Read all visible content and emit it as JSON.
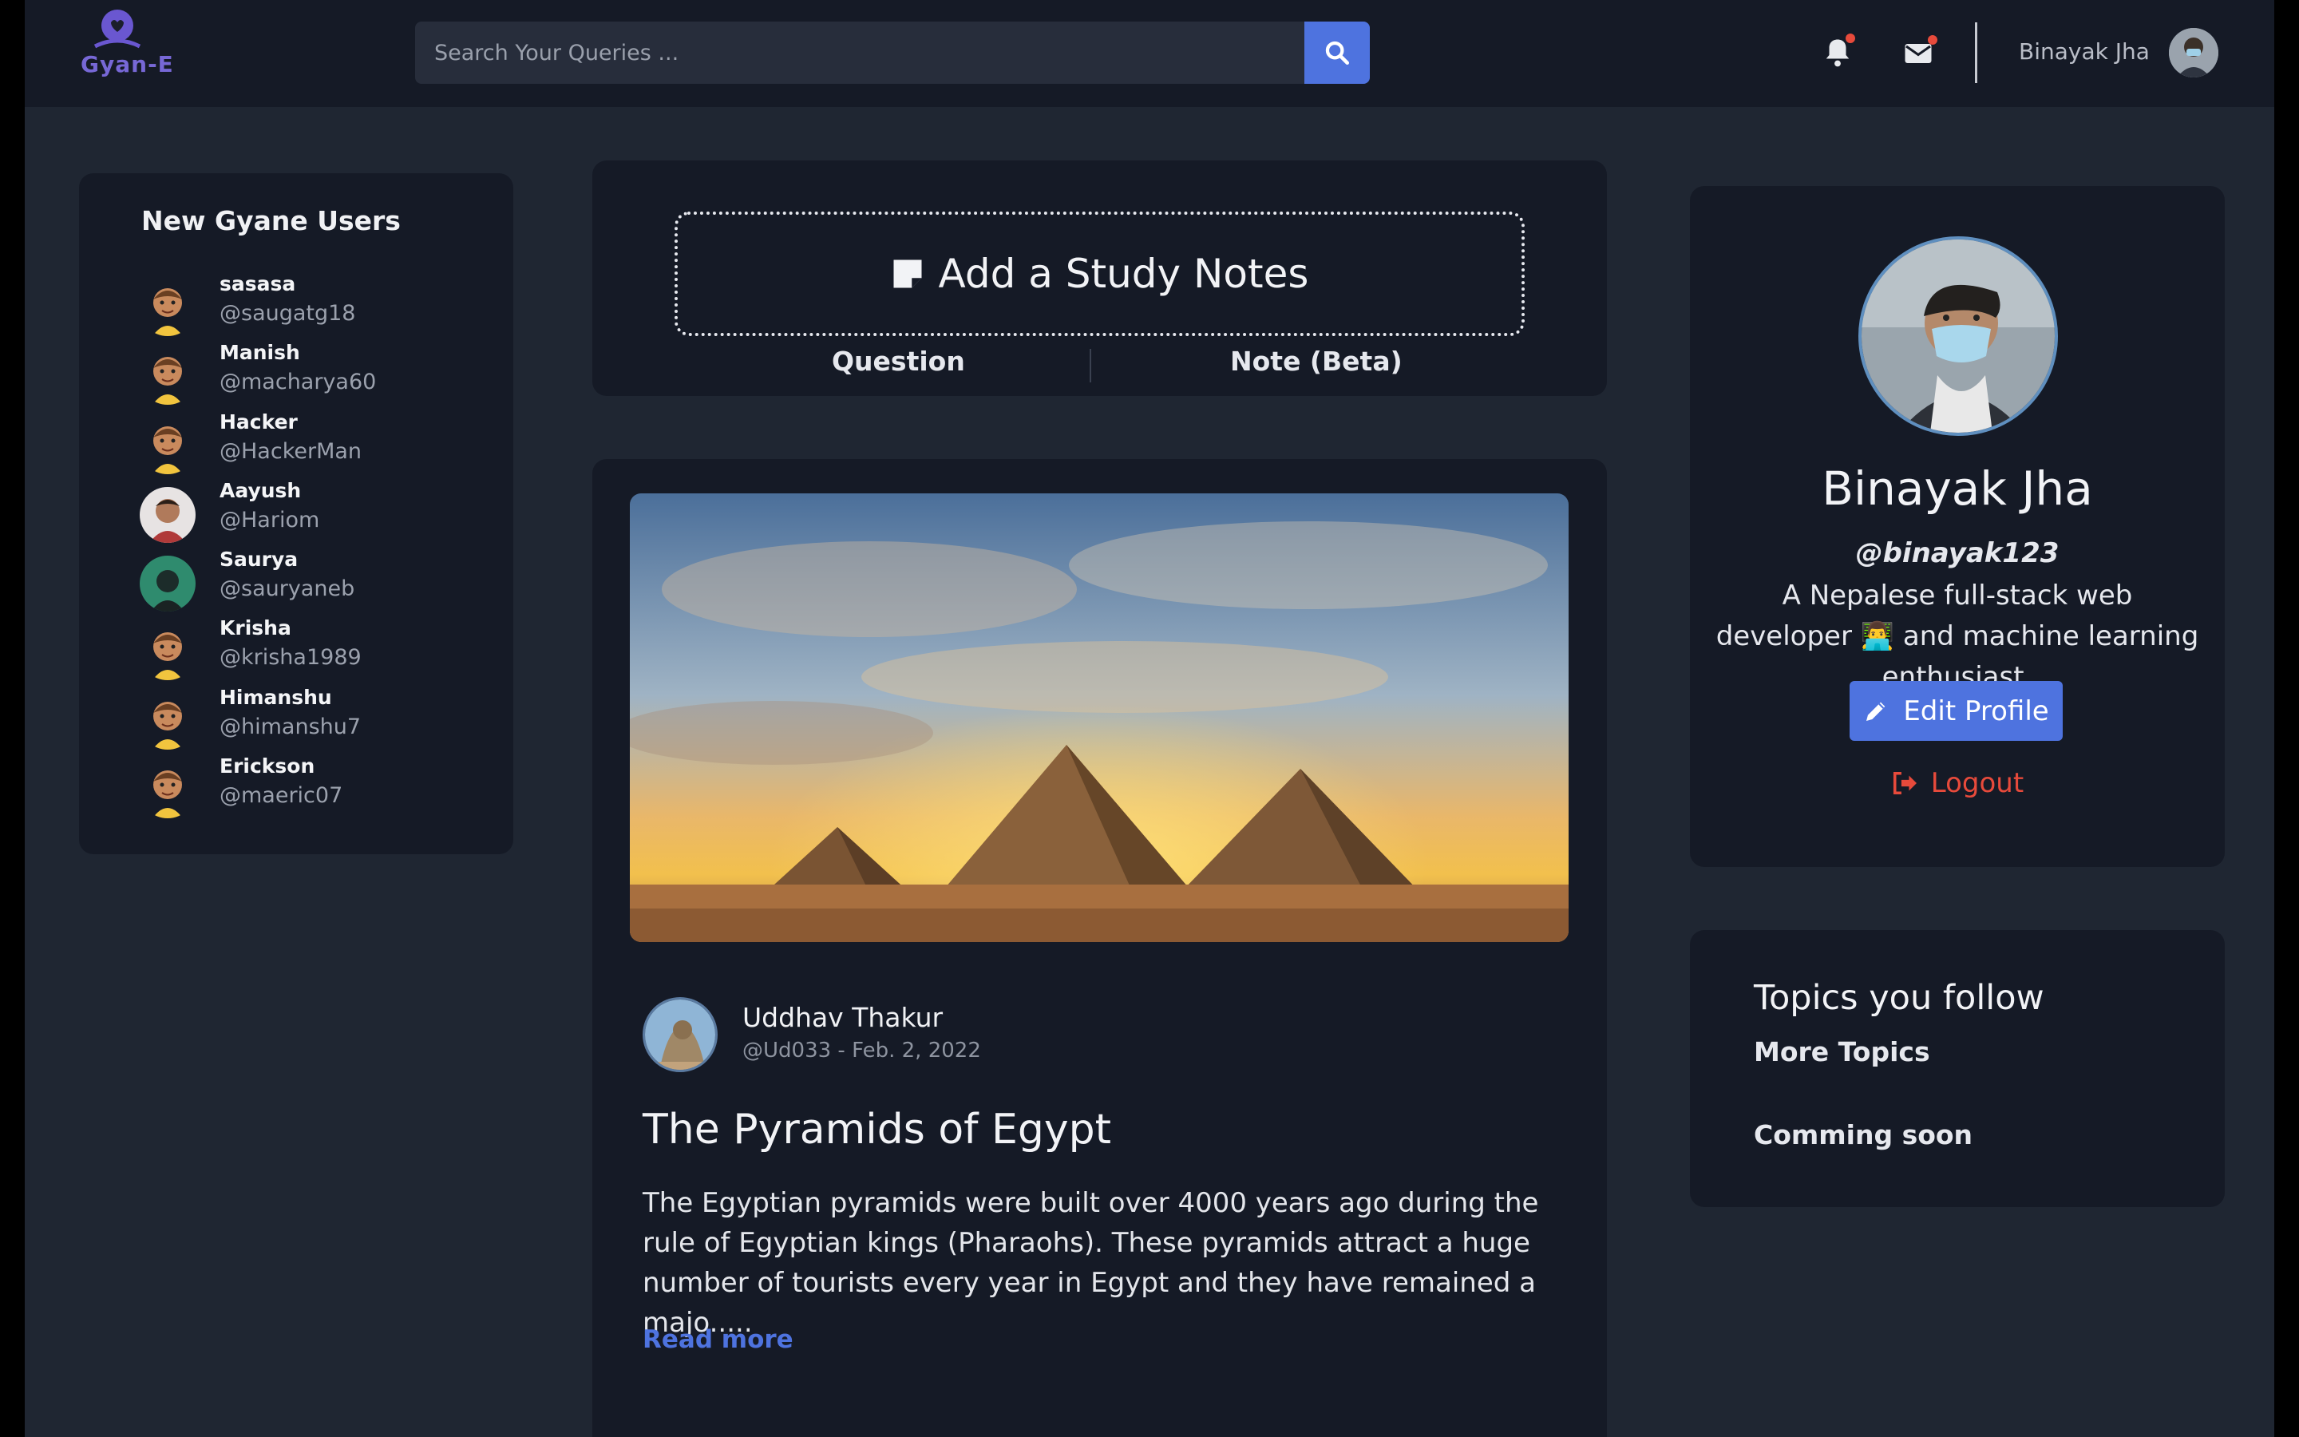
{
  "navbar": {
    "logo_text": "Gyan-E",
    "search_placeholder": "Search Your Queries ...",
    "username": "Binayak Jha",
    "icons": [
      "bell-icon",
      "envelope-icon",
      "search-icon"
    ]
  },
  "users_panel": {
    "title": "New Gyane Users",
    "users": [
      {
        "name": "sasasa",
        "handle": "@saugatg18"
      },
      {
        "name": "Manish",
        "handle": "@macharya60"
      },
      {
        "name": "Hacker",
        "handle": "@HackerMan"
      },
      {
        "name": "Aayush",
        "handle": "@Hariom"
      },
      {
        "name": "Saurya",
        "handle": "@sauryaneb"
      },
      {
        "name": "Krisha",
        "handle": "@krisha1989"
      },
      {
        "name": "Himanshu",
        "handle": "@himanshu7"
      },
      {
        "name": "Erickson",
        "handle": "@maeric07"
      }
    ]
  },
  "compose": {
    "label": "Add a Study Notes",
    "tab_question": "Question",
    "tab_note": "Note (Beta)"
  },
  "post": {
    "author_name": "Uddhav Thakur",
    "author_meta": "@Ud033 - Feb. 2, 2022",
    "title": "The Pyramids of Egypt",
    "body": "The Egyptian pyramids were built over 4000 years ago during the rule of Egyptian kings (Pharaohs). These pyramids attract a huge number of tourists every year in Egypt and they have remained a majo.....",
    "read_more": "Read more"
  },
  "profile": {
    "name": "Binayak Jha",
    "handle": "@binayak123",
    "bio": "A Nepalese full-stack web developer 👨‍💻 and machine learning enthusiast.",
    "edit_label": "Edit Profile",
    "logout_label": "Logout"
  },
  "topics": {
    "title": "Topics you follow",
    "more": "More Topics",
    "soon": "Comming soon"
  },
  "colors": {
    "accent": "#4e73df",
    "danger": "#e74a3b",
    "card_bg": "#151a26",
    "page_bg": "#1f2632"
  }
}
